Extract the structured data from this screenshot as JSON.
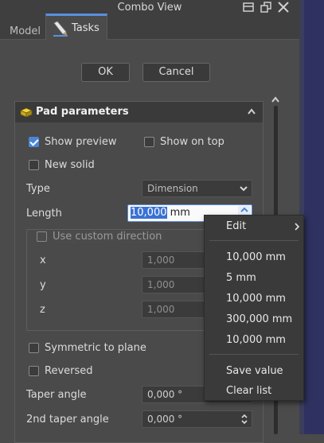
{
  "window": {
    "title": "Combo View"
  },
  "tabs": [
    {
      "label": "Model"
    },
    {
      "label": "Tasks"
    }
  ],
  "dialog": {
    "ok_label": "OK",
    "cancel_label": "Cancel"
  },
  "panel": {
    "title": "Pad parameters",
    "show_preview": {
      "label": "Show preview",
      "checked": true
    },
    "show_on_top": {
      "label": "Show on top",
      "checked": false
    },
    "new_solid": {
      "label": "New solid",
      "checked": false
    },
    "type": {
      "label": "Type",
      "value": "Dimension"
    },
    "length": {
      "label": "Length",
      "value_selected": "10,000",
      "unit": " mm"
    },
    "custom_direction": {
      "label": "Use custom direction",
      "x": {
        "label": "x",
        "value": "1,000"
      },
      "y": {
        "label": "y",
        "value": "1,000"
      },
      "z": {
        "label": "z",
        "value": "1,000"
      }
    },
    "symmetric": {
      "label": "Symmetric to plane",
      "checked": false
    },
    "reversed": {
      "label": "Reversed",
      "checked": false
    },
    "taper_angle": {
      "label": "Taper angle",
      "value": "0,000 °"
    },
    "taper_angle_2": {
      "label": "2nd taper angle",
      "value": "0,000 °"
    }
  },
  "context_menu": {
    "edit": "Edit",
    "history": [
      "10,000 mm",
      "5 mm",
      "10,000 mm",
      "300,000 mm",
      "10,000 mm"
    ],
    "save_value": "Save value",
    "clear_list": "Clear list"
  },
  "colors": {
    "accent": "#4a86d8",
    "tab_highlight": "#5b8fe0",
    "background": "#4b4b4b"
  },
  "icons": [
    "float-icon",
    "undock-icon",
    "close-icon",
    "pencil-icon",
    "pad-icon",
    "chevron-up-icon",
    "chevron-down-icon",
    "chevron-right-icon",
    "spin-icon"
  ]
}
